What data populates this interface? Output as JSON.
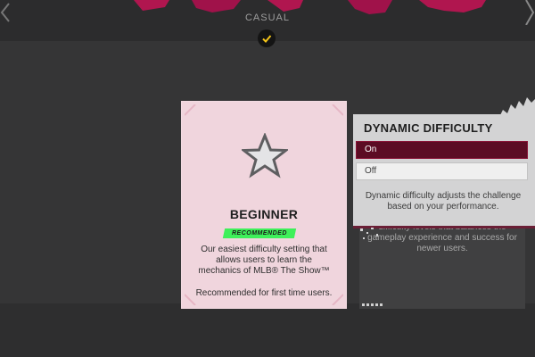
{
  "header": {
    "mode_label": "CASUAL",
    "selected_icon": "checkmark-icon"
  },
  "difficulty_card": {
    "icon": "star-icon",
    "title": "BEGINNER",
    "badge": "RECOMMENDED",
    "description": "Our easiest difficulty setting that allows users to learn the mechanics of MLB® The Show™",
    "note": "Recommended for first time users."
  },
  "background_card": {
    "partial_text": "difficulty levels that balances the gameplay experience and success for newer users."
  },
  "dynamic_difficulty": {
    "title": "DYNAMIC DIFFICULTY",
    "options": [
      {
        "label": "On",
        "selected": true
      },
      {
        "label": "Off",
        "selected": false
      }
    ],
    "description": "Dynamic difficulty adjusts the challenge based on your performance."
  },
  "colors": {
    "accent_pink": "#c2185b",
    "selected_option": "#5c0c24",
    "recommended_green": "#3ef05a",
    "card_bg": "#f0d5dd"
  }
}
